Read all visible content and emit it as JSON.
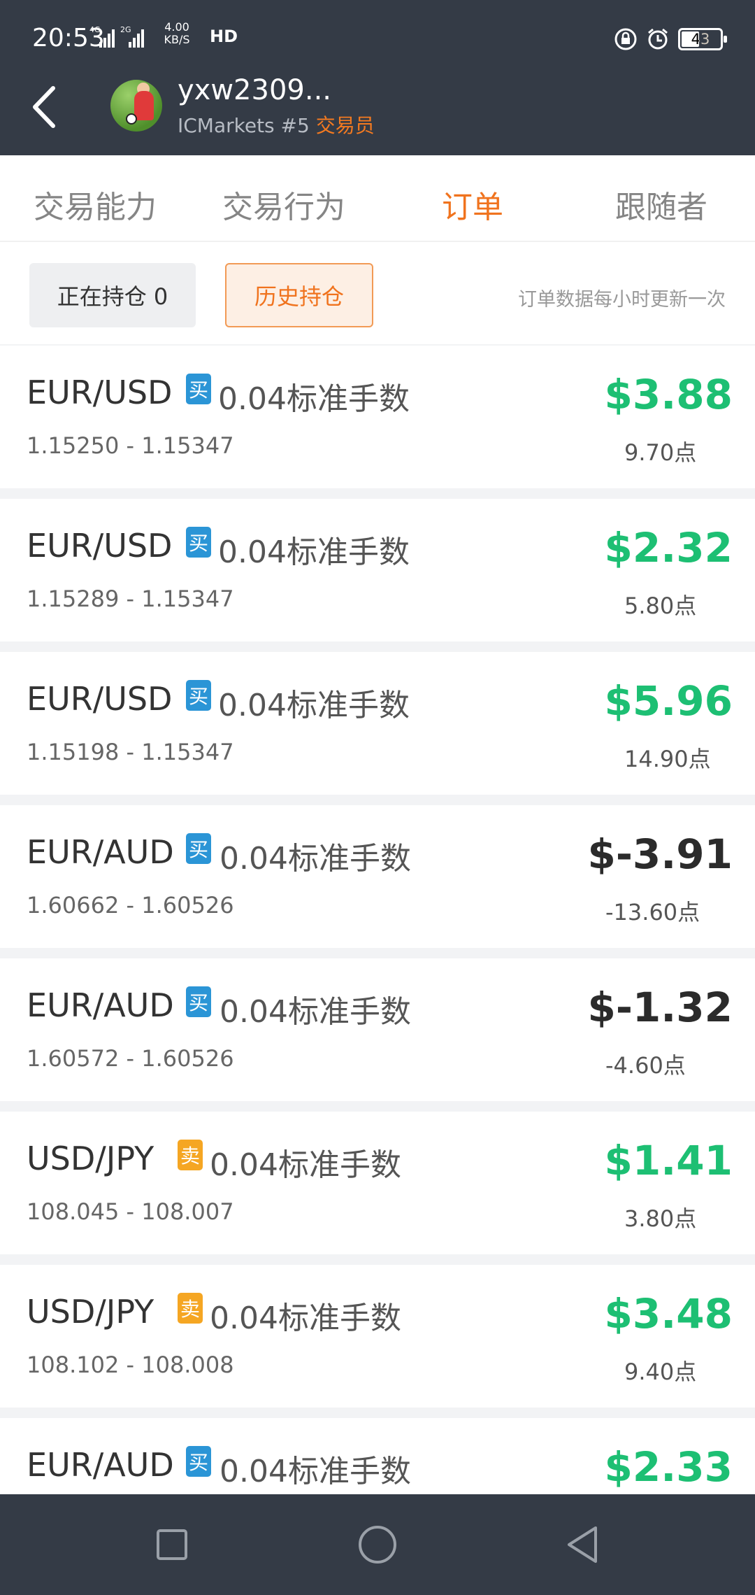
{
  "status_bar": {
    "time": "20:53",
    "speed_top": "4.00",
    "speed_bottom": "KB/S",
    "hd": "HD",
    "battery": "43"
  },
  "header": {
    "username": "yxw2309...",
    "broker": "ICMarkets #5",
    "role": "交易员"
  },
  "tabs": [
    {
      "label": "交易能力",
      "active": false
    },
    {
      "label": "交易行为",
      "active": false
    },
    {
      "label": "订单",
      "active": true
    },
    {
      "label": "跟随者",
      "active": false
    }
  ],
  "filter": {
    "open_positions": "正在持仓 0",
    "history": "历史持仓",
    "note": "订单数据每小时更新一次"
  },
  "orders": [
    {
      "pair": "EUR/USD",
      "side": "买",
      "lots": "0.04标准手数",
      "range": "1.15250 - 1.15347",
      "profit": "$3.88",
      "points": "9.70点",
      "positive": true
    },
    {
      "pair": "EUR/USD",
      "side": "买",
      "lots": "0.04标准手数",
      "range": "1.15289 - 1.15347",
      "profit": "$2.32",
      "points": "5.80点",
      "positive": true
    },
    {
      "pair": "EUR/USD",
      "side": "买",
      "lots": "0.04标准手数",
      "range": "1.15198 - 1.15347",
      "profit": "$5.96",
      "points": "14.90点",
      "positive": true
    },
    {
      "pair": "EUR/AUD",
      "side": "买",
      "lots": "0.04标准手数",
      "range": "1.60662 - 1.60526",
      "profit": "$-3.91",
      "points": "-13.60点",
      "positive": false
    },
    {
      "pair": "EUR/AUD",
      "side": "买",
      "lots": "0.04标准手数",
      "range": "1.60572 - 1.60526",
      "profit": "$-1.32",
      "points": "-4.60点",
      "positive": false
    },
    {
      "pair": "USD/JPY",
      "side": "卖",
      "lots": "0.04标准手数",
      "range": "108.045 - 108.007",
      "profit": "$1.41",
      "points": "3.80点",
      "positive": true
    },
    {
      "pair": "USD/JPY",
      "side": "卖",
      "lots": "0.04标准手数",
      "range": "108.102 - 108.008",
      "profit": "$3.48",
      "points": "9.40点",
      "positive": true
    },
    {
      "pair": "EUR/AUD",
      "side": "买",
      "lots": "0.04标准手数",
      "range": "",
      "profit": "$2.33",
      "points": "",
      "positive": true
    }
  ],
  "colors": {
    "header_bg": "#343b46",
    "accent": "#f0731e",
    "profit_positive": "#1dbf73",
    "profit_negative": "#2b2b2b",
    "buy_badge": "#2b95d6",
    "sell_badge": "#f5a623"
  },
  "icons": {
    "back": "back-arrow-icon",
    "nav_recent": "square-icon",
    "nav_home": "circle-icon",
    "nav_back": "triangle-back-icon"
  }
}
